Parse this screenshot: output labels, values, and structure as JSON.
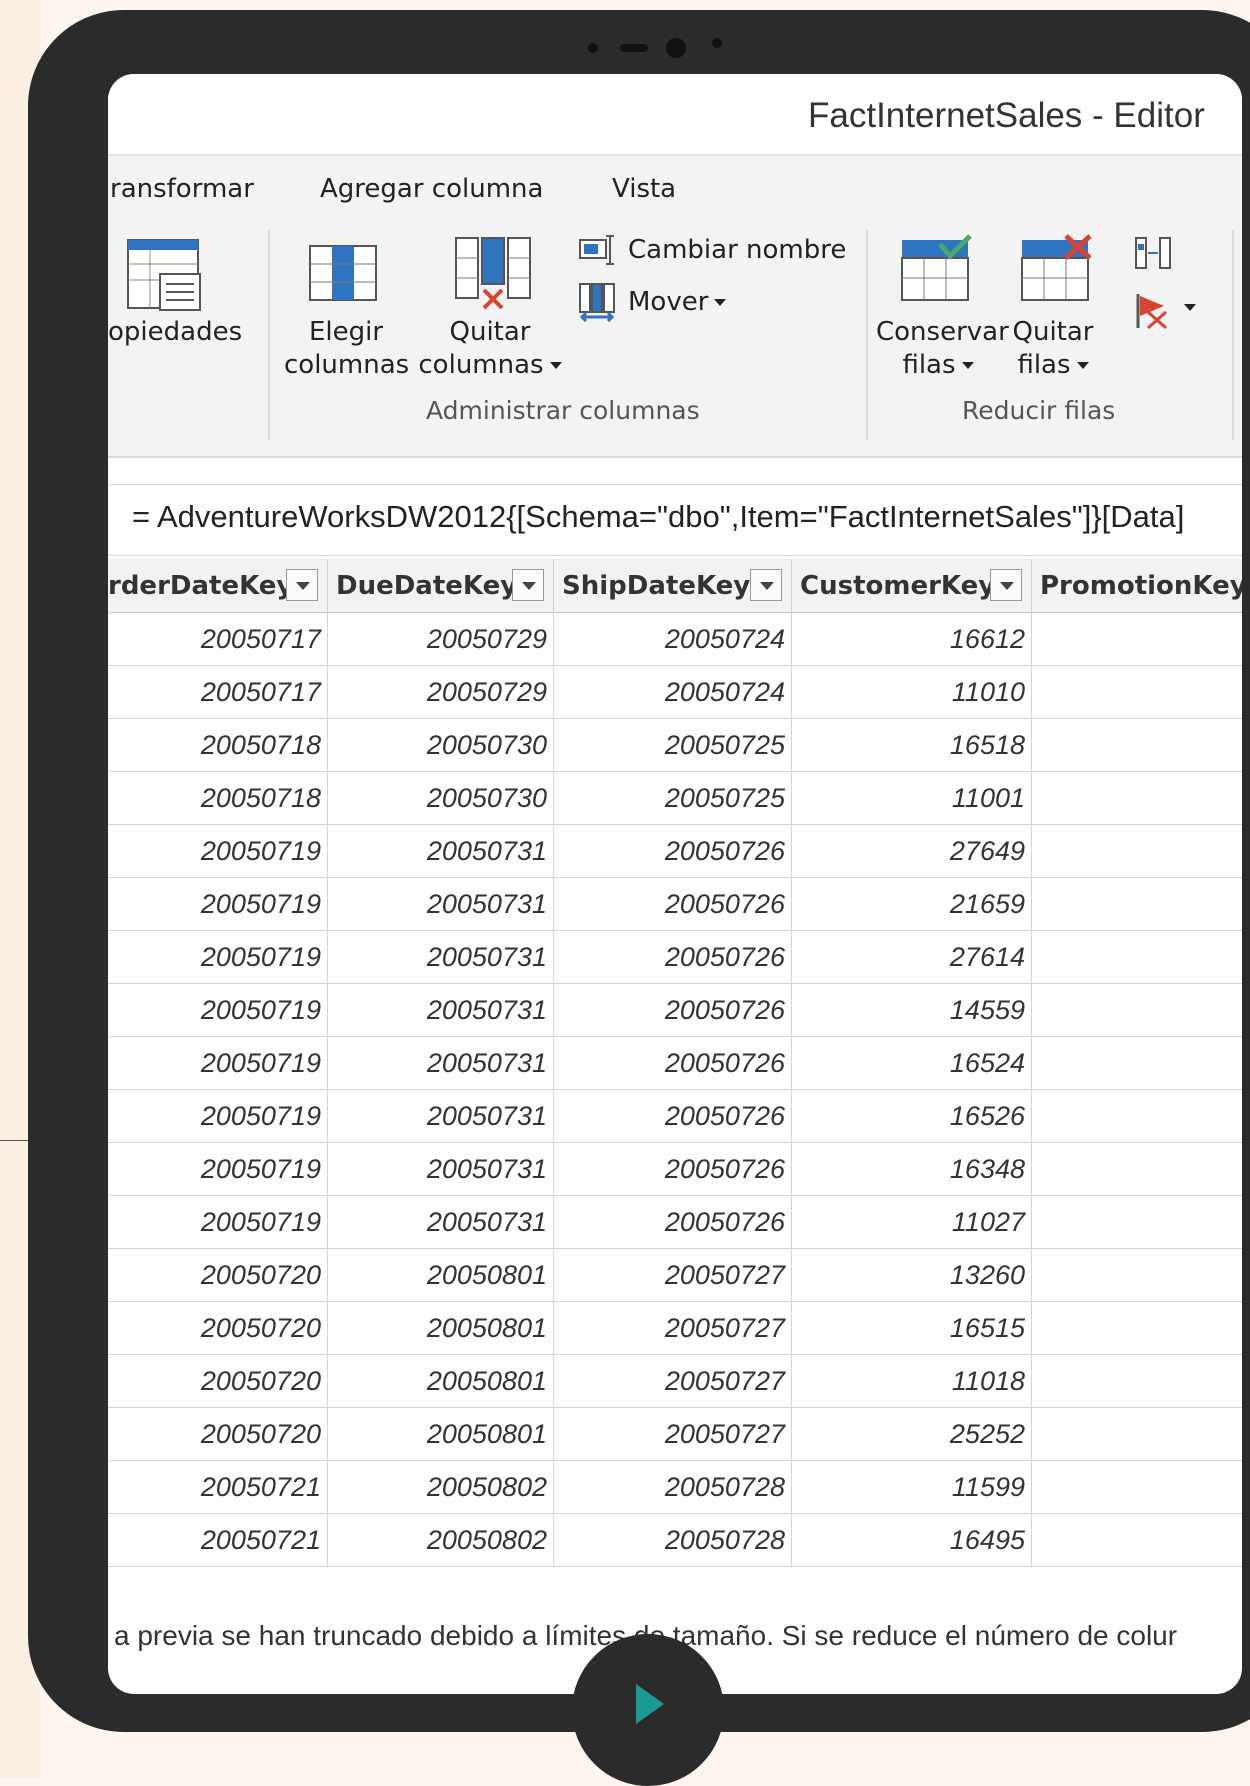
{
  "window": {
    "title": "FactInternetSales - Editor"
  },
  "tabs": [
    "ransformar",
    "Agregar columna",
    "Vista"
  ],
  "ribbon": {
    "propiedades": "opiedades",
    "elegir_columnas": [
      "Elegir",
      "columnas"
    ],
    "quitar_columnas": [
      "Quitar",
      "columnas"
    ],
    "cambiar_nombre": "Cambiar nombre",
    "mover": "Mover",
    "group_administrar": "Administrar columnas",
    "conservar_filas": [
      "Conservar",
      "filas"
    ],
    "quitar_filas": [
      "Quitar",
      "filas"
    ],
    "group_reducir": "Reducir filas"
  },
  "formula": "= AdventureWorksDW2012{[Schema=\"dbo\",Item=\"FactInternetSales\"]}[Data]",
  "grid": {
    "columns": [
      "rderDateKey",
      "DueDateKey",
      "ShipDateKey",
      "CustomerKey",
      "PromotionKey"
    ],
    "rows": [
      [
        "20050717",
        "20050729",
        "20050724",
        "16612"
      ],
      [
        "20050717",
        "20050729",
        "20050724",
        "11010"
      ],
      [
        "20050718",
        "20050730",
        "20050725",
        "16518"
      ],
      [
        "20050718",
        "20050730",
        "20050725",
        "11001"
      ],
      [
        "20050719",
        "20050731",
        "20050726",
        "27649"
      ],
      [
        "20050719",
        "20050731",
        "20050726",
        "21659"
      ],
      [
        "20050719",
        "20050731",
        "20050726",
        "27614"
      ],
      [
        "20050719",
        "20050731",
        "20050726",
        "14559"
      ],
      [
        "20050719",
        "20050731",
        "20050726",
        "16524"
      ],
      [
        "20050719",
        "20050731",
        "20050726",
        "16526"
      ],
      [
        "20050719",
        "20050731",
        "20050726",
        "16348"
      ],
      [
        "20050719",
        "20050731",
        "20050726",
        "11027"
      ],
      [
        "20050720",
        "20050801",
        "20050727",
        "13260"
      ],
      [
        "20050720",
        "20050801",
        "20050727",
        "16515"
      ],
      [
        "20050720",
        "20050801",
        "20050727",
        "11018"
      ],
      [
        "20050720",
        "20050801",
        "20050727",
        "25252"
      ],
      [
        "20050721",
        "20050802",
        "20050728",
        "11599"
      ],
      [
        "20050721",
        "20050802",
        "20050728",
        "16495"
      ]
    ]
  },
  "status": "a previa se han truncado debido a límites de tamaño. Si se reduce el número de colur",
  "colors": {
    "accent": "#1a9a93",
    "frame": "#2b2b2b",
    "ribbon_blue": "#2e74c0",
    "remove_red": "#d9432f"
  }
}
